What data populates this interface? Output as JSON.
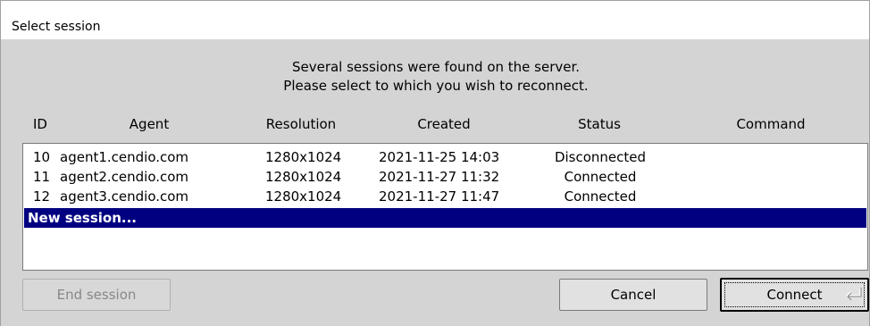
{
  "window": {
    "title": "Select session"
  },
  "message": {
    "line1": "Several sessions were found on the server.",
    "line2": "Please select to which you wish to reconnect."
  },
  "columns": [
    "ID",
    "Agent",
    "Resolution",
    "Created",
    "Status",
    "Command"
  ],
  "sessions": [
    {
      "id": "10",
      "agent": "agent1.cendio.com",
      "resolution": "1280x1024",
      "created": "2021-11-25 14:03",
      "status": "Disconnected",
      "command": ""
    },
    {
      "id": "11",
      "agent": "agent2.cendio.com",
      "resolution": "1280x1024",
      "created": "2021-11-27 11:32",
      "status": "Connected",
      "command": ""
    },
    {
      "id": "12",
      "agent": "agent3.cendio.com",
      "resolution": "1280x1024",
      "created": "2021-11-27 11:47",
      "status": "Connected",
      "command": ""
    }
  ],
  "new_session": {
    "label": "New session...",
    "selected": true
  },
  "buttons": {
    "end_session": "End session",
    "cancel": "Cancel",
    "connect": "Connect"
  },
  "colors": {
    "selection": "#000080",
    "dialog_bg": "#d4d4d4"
  },
  "icons": {
    "connect": "enter-key-icon"
  }
}
